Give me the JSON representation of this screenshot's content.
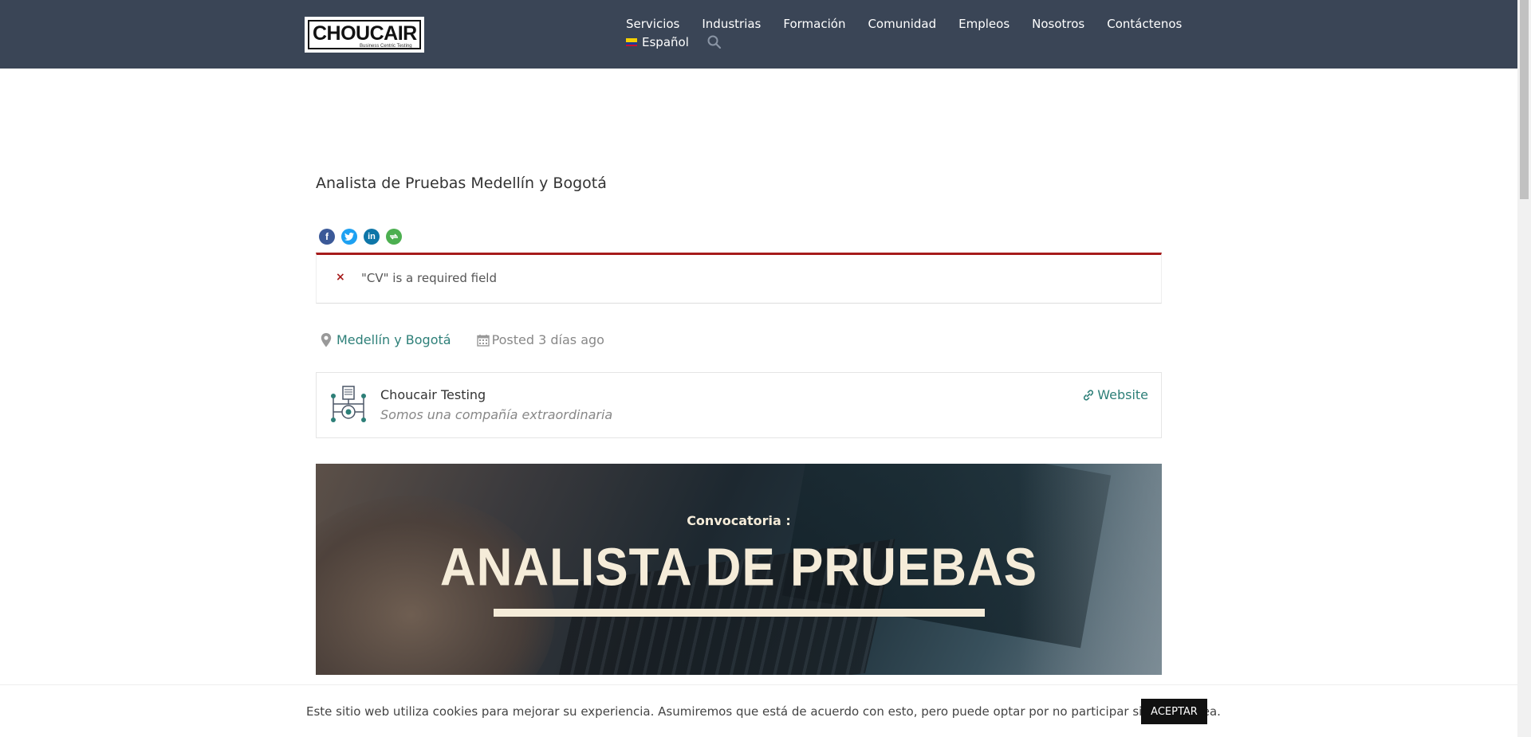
{
  "header": {
    "logo_text": "CHOUCAIR",
    "logo_sub": "Business Centric Testing",
    "nav": [
      "Servicios",
      "Industrias",
      "Formación",
      "Comunidad",
      "Empleos",
      "Nosotros",
      "Contáctenos"
    ],
    "language": "Español"
  },
  "job": {
    "title": "Analista de Pruebas Medellín y Bogotá",
    "error": "\"CV\" is a required field",
    "location": "Medellín y Bogotá",
    "posted": "Posted 3 días ago"
  },
  "company": {
    "name": "Choucair Testing",
    "tagline": "Somos una compañía extraordinaria",
    "website_label": "Website"
  },
  "banner": {
    "subtitle": "Convocatoria :",
    "title": "ANALISTA DE PRUEBAS"
  },
  "cookie": {
    "text": "Este sitio web utiliza cookies para mejorar su experiencia. Asumiremos que está de acuerdo con esto, pero puede optar por no participar si así lo desea.",
    "accept": "ACEPTAR"
  },
  "colors": {
    "header_bg": "#3a4556",
    "accent": "#2d7f78",
    "error": "#a61b1b"
  }
}
